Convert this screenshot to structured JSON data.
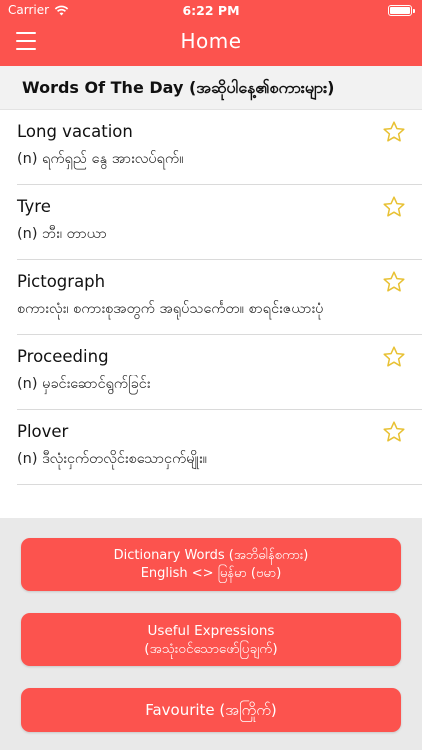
{
  "status_bar": {
    "carrier": "Carrier",
    "time": "6:22 PM"
  },
  "nav": {
    "title": "Home",
    "menu_icon": "hamburger-menu-icon"
  },
  "section": {
    "title": "Words Of The Day (အဆိုပါနေ့၏စကားများ)"
  },
  "words": [
    {
      "word": "Long vacation",
      "definition": "(n) ရက်ရှည် နွေ အားလပ်ရက်။",
      "starred": false
    },
    {
      "word": "Tyre",
      "definition": "(n) ဘီး၊ တာယာ",
      "starred": false
    },
    {
      "word": "Pictograph",
      "definition": "စကားလုံး၊ စကားစုအတွက် အရုပ်သင်္ကေတ။ စာရင်းဇယားပုံ",
      "starred": false
    },
    {
      "word": "Proceeding",
      "definition": "(n) မှခင်းဆောင်ရွက်ခြင်း",
      "starred": false
    },
    {
      "word": "Plover",
      "definition": "(n) ဒီလုံးငှက်တလိုင်းစသောငှက်မျိုး။",
      "starred": false
    }
  ],
  "buttons": {
    "dictionary_line1": "Dictionary Words (အဘိဓါန်စကား)",
    "dictionary_line2": "English <> မြန်မာ (ဗမာ)",
    "expressions_line1": "Useful Expressions",
    "expressions_line2": "(အသုံးဝင်သောဖော်ပြချက်)",
    "favourite": "Favourite (အကြိုက်)"
  },
  "colors": {
    "accent": "#fc534e",
    "star": "#e8c133",
    "bottom_panel": "#e9e9e9"
  }
}
